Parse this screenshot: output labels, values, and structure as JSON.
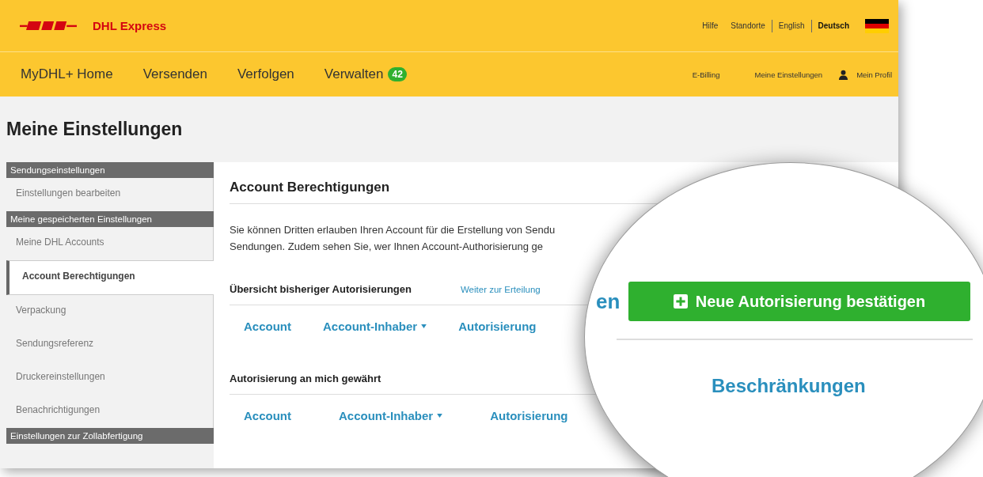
{
  "header": {
    "brand": "DHL Express",
    "top_links": [
      "Hilfe",
      "Standorte"
    ],
    "languages": [
      {
        "label": "English",
        "selected": false
      },
      {
        "label": "Deutsch",
        "selected": true
      }
    ],
    "nav": [
      {
        "label": "MyDHL+ Home"
      },
      {
        "label": "Versenden"
      },
      {
        "label": "Verfolgen"
      },
      {
        "label": "Verwalten",
        "badge": "42"
      }
    ],
    "nav_right": [
      "E-Billing",
      "Meine Einstellungen"
    ],
    "profile": "Mein Profil"
  },
  "page_title": "Meine Einstellungen",
  "sidebar": [
    {
      "heading": "Sendungseinstellungen",
      "items": [
        {
          "label": "Einstellungen bearbeiten",
          "selected": false
        }
      ]
    },
    {
      "heading": "Meine gespeicherten Einstellungen",
      "items": [
        {
          "label": "Meine DHL Accounts",
          "selected": false
        },
        {
          "label": "Account Berechtigungen",
          "selected": true
        },
        {
          "label": "Verpackung",
          "selected": false
        },
        {
          "label": "Sendungsreferenz",
          "selected": false
        },
        {
          "label": "Druckereinstellungen",
          "selected": false
        },
        {
          "label": "Benachrichtigungen",
          "selected": false
        }
      ]
    },
    {
      "heading": "Einstellungen zur Zollabfertigung"
    }
  ],
  "content": {
    "title": "Account Berechtigungen",
    "description": [
      "Sie können Dritten erlauben Ihren Account für die Erstellung von Sendu",
      "Sendungen. Zudem sehen Sie, wer Ihnen Account-Authorisierung ge"
    ],
    "sections": [
      {
        "heading": "Übersicht bisheriger Autorisierungen",
        "link": "Weiter zur Erteilung",
        "columns": [
          {
            "label": "Account",
            "sorted": false
          },
          {
            "label": "Account-Inhaber",
            "sorted": true
          },
          {
            "label": "Autorisierung",
            "sorted": false
          }
        ]
      },
      {
        "heading": "Autorisierung an mich gewährt",
        "columns": [
          {
            "label": "Account",
            "sorted": false
          },
          {
            "label": "Account-Inhaber",
            "sorted": true
          },
          {
            "label": "Autorisierung",
            "sorted": false
          }
        ]
      }
    ]
  },
  "magnifier": {
    "partial_text": "en",
    "button": "Neue Autorisierung bestätigen",
    "column": "Beschränkungen"
  }
}
